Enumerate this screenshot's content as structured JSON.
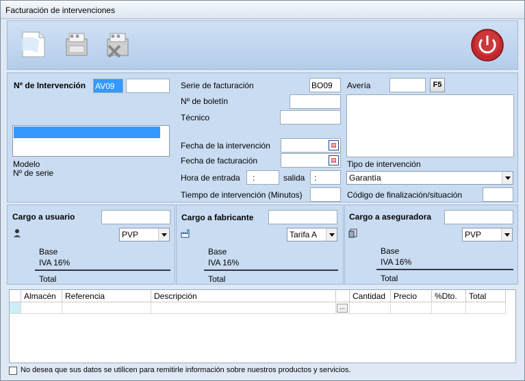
{
  "window": {
    "title": "Facturación de intervenciones"
  },
  "toolbar": {
    "icons": [
      "new-document-icon",
      "print-icon",
      "delete-print-icon",
      "power-icon"
    ]
  },
  "intervencion": {
    "num_label": "Nº de Intervención",
    "num_value": "AV09",
    "num_extra": "",
    "modelo_label": "Modelo",
    "serie_label": "Nº de serie"
  },
  "facturacion": {
    "serie_label": "Serie de facturación",
    "serie_value": "BO09",
    "boletin_label": "Nº de boletín",
    "tecnico_label": "Técnico",
    "fecha_intervencion_label": "Fecha de la intervención",
    "fecha_facturacion_label": "Fecha de facturación",
    "hora_entrada_label": "Hora de entrada",
    "hora_entrada_value": ":",
    "salida_label": "salida",
    "salida_value": ":",
    "tiempo_label": "Tiempo de intervención (Minutos)"
  },
  "averia": {
    "label": "Avería",
    "f5_label": "F5",
    "tipo_label": "Tipo de intervención",
    "tipo_value": "Garantía",
    "codigo_label": "Código de finalización/situación"
  },
  "cargos": [
    {
      "title": "Cargo a usuario",
      "tarifa": "PVP",
      "base": "Base",
      "iva": "IVA 16%",
      "total": "Total",
      "icon": "user-icon"
    },
    {
      "title": "Cargo a fabricante",
      "tarifa": "Tarifa A",
      "base": "Base",
      "iva": "IVA 16%",
      "total": "Total",
      "icon": "factory-icon"
    },
    {
      "title": "Cargo a aseguradora",
      "tarifa": "PVP",
      "base": "Base",
      "iva": "IVA 16%",
      "total": "Total",
      "icon": "insurance-icon"
    }
  ],
  "grid": {
    "columns": [
      "Almacén",
      "Referencia",
      "Descripción",
      "Cantidad",
      "Precio",
      "%Dto.",
      "Total"
    ],
    "ellipsis": "..."
  },
  "footer": {
    "checkbox_label": "No desea que sus datos se utilicen para remitirle información sobre nuestros productos y servicios."
  },
  "colors": {
    "selection": "#3399ff",
    "panel": "#c9dcf2",
    "window": "#dfe9f5",
    "power_red": "#c0282d"
  }
}
